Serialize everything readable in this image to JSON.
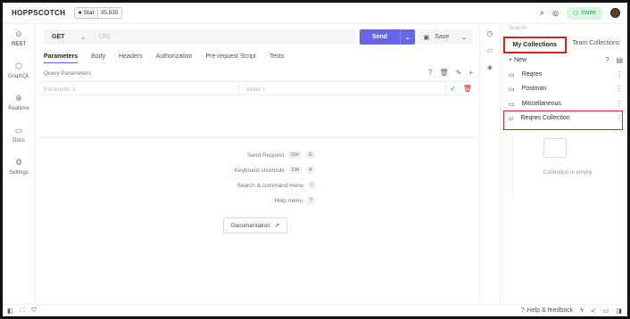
{
  "header": {
    "logo": "HOPPSCOTCH",
    "github_star_label": "Star",
    "github_star_count": "35,835",
    "invite_label": "Invite"
  },
  "nav": {
    "items": [
      {
        "label": "REST",
        "icon": "link-icon"
      },
      {
        "label": "GraphQL",
        "icon": "graphql-icon"
      },
      {
        "label": "Realtime",
        "icon": "globe-icon"
      },
      {
        "label": "Docs",
        "icon": "book-icon"
      },
      {
        "label": "Settings",
        "icon": "gear-icon"
      }
    ]
  },
  "request": {
    "method": "GET",
    "url_placeholder": "URL",
    "send_label": "Send",
    "save_label": "Save"
  },
  "tabs": [
    "Parameters",
    "Body",
    "Headers",
    "Authorization",
    "Pre-request Script",
    "Tests"
  ],
  "params": {
    "title": "Query Parameters",
    "key_placeholder": "Parameter 1",
    "value_placeholder": "Value 1"
  },
  "shortcuts": [
    {
      "label": "Send Request",
      "keys": [
        "Ctrl",
        "G"
      ]
    },
    {
      "label": "Keyboard shortcuts",
      "keys": [
        "Ctrl",
        "K"
      ]
    },
    {
      "label": "Search & command menu",
      "keys": [
        "/"
      ]
    },
    {
      "label": "Help menu",
      "keys": [
        "?"
      ]
    }
  ],
  "documentation_label": "Documentation",
  "collections": {
    "search_placeholder": "Search",
    "tab_my": "My Collections",
    "tab_team": "Team Collections",
    "new_label": "New",
    "items": [
      "Reqres",
      "Postman",
      "Miscellaneous",
      "Reqres Collection"
    ],
    "empty_text": "Collection is empty"
  },
  "footer": {
    "help_label": "Help & feedback"
  }
}
